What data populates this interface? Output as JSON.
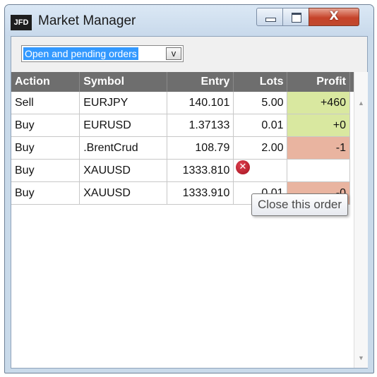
{
  "window": {
    "app_icon_text": "JFD",
    "title": "Market Manager",
    "controls": {
      "minimize_icon": "minimize-icon",
      "maximize_icon": "maximize-icon",
      "close_glyph": "X"
    }
  },
  "filter": {
    "selected": "Open and pending orders",
    "dropdown_glyph": "v"
  },
  "table": {
    "columns": [
      "Action",
      "Symbol",
      "Entry",
      "Lots",
      "Profit"
    ],
    "rows": [
      {
        "action": "Sell",
        "symbol": "EURJPY",
        "entry": "140.101",
        "lots": "5.00",
        "profit": "+460",
        "profit_state": "positive"
      },
      {
        "action": "Buy",
        "symbol": "EURUSD",
        "entry": "1.37133",
        "lots": "0.01",
        "profit": "+0",
        "profit_state": "positive"
      },
      {
        "action": "Buy",
        "symbol": ".BrentCrud",
        "entry": "108.79",
        "lots": "2.00",
        "profit": "-1",
        "profit_state": "negative"
      },
      {
        "action": "Buy",
        "symbol": "XAUUSD",
        "entry": "1333.810",
        "lots": "",
        "profit": "",
        "profit_state": "hidden"
      },
      {
        "action": "Buy",
        "symbol": "XAUUSD",
        "entry": "1333.910",
        "lots": "0.01",
        "profit": "-0",
        "profit_state": "negative"
      }
    ]
  },
  "close_order_icon": "close-order-icon",
  "close_order_glyph": "✕",
  "tooltip": "Close this order",
  "scrollbar": {
    "up_glyph": "▲",
    "down_glyph": "▼"
  },
  "colors": {
    "profit_positive": "#d9e8a0",
    "profit_negative": "#e9b4a0",
    "header_bg": "#6e6e6e",
    "selection": "#3399ff",
    "close_button": "#c6432a"
  }
}
